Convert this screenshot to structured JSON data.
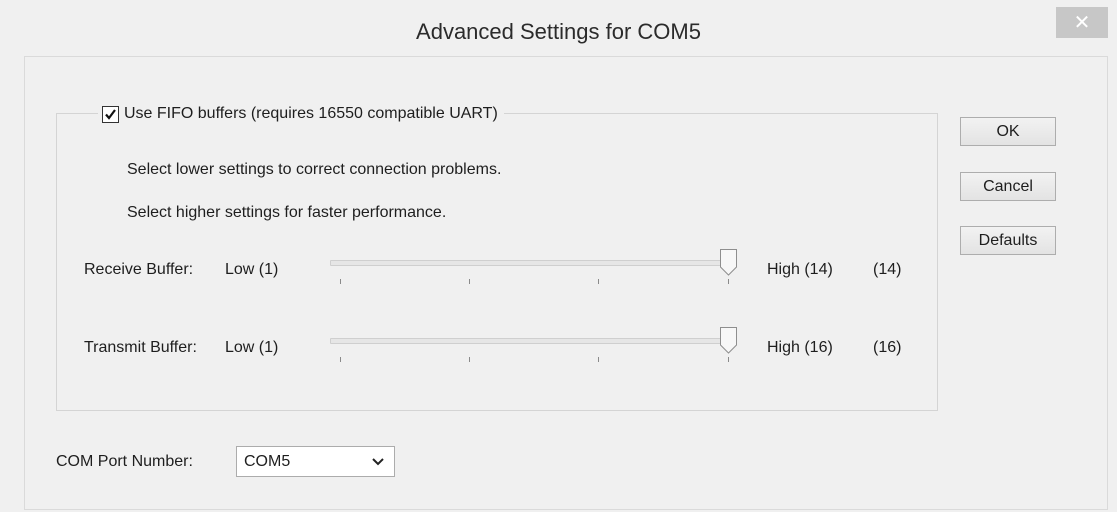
{
  "window": {
    "title": "Advanced Settings for COM5",
    "close_glyph": "✕"
  },
  "fifo": {
    "checkbox_label": "Use FIFO buffers (requires 16550 compatible UART)",
    "checked": true,
    "hint_lower": "Select lower settings to correct connection problems.",
    "hint_higher": "Select higher settings for faster performance."
  },
  "receive_buffer": {
    "label": "Receive Buffer:",
    "low_label": "Low (1)",
    "high_label": "High (14)",
    "current_value": "(14)",
    "min": 1,
    "max": 14,
    "value": 14
  },
  "transmit_buffer": {
    "label": "Transmit Buffer:",
    "low_label": "Low (1)",
    "high_label": "High (16)",
    "current_value": "(16)",
    "min": 1,
    "max": 16,
    "value": 16
  },
  "buttons": {
    "ok": "OK",
    "cancel": "Cancel",
    "defaults": "Defaults"
  },
  "com_port": {
    "label": "COM Port Number:",
    "selected": "COM5"
  }
}
